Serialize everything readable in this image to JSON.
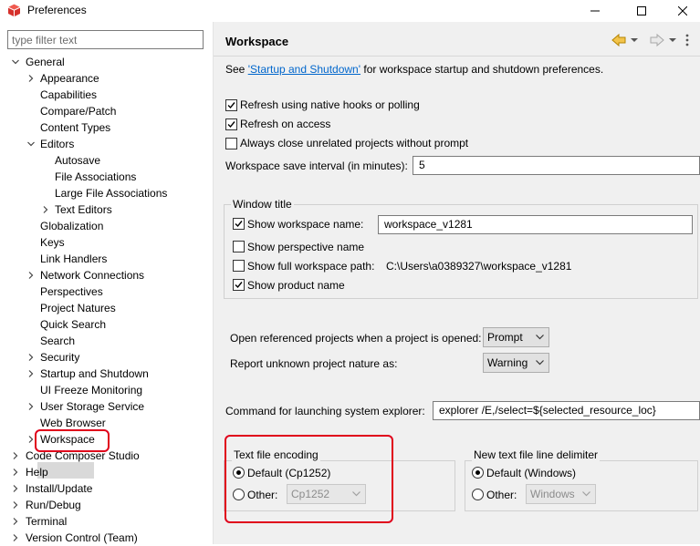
{
  "window": {
    "title": "Preferences",
    "icon": "preferences-app-icon",
    "controls": [
      "minimize-icon",
      "maximize-icon",
      "close-icon"
    ]
  },
  "filter": {
    "placeholder": "type filter text",
    "value": ""
  },
  "tree": {
    "general": "General",
    "appearance": "Appearance",
    "capabilities": "Capabilities",
    "compare_patch": "Compare/Patch",
    "content_types": "Content Types",
    "editors": "Editors",
    "autosave": "Autosave",
    "file_associations": "File Associations",
    "large_file_associations": "Large File Associations",
    "text_editors": "Text Editors",
    "globalization": "Globalization",
    "keys": "Keys",
    "link_handlers": "Link Handlers",
    "network_connections": "Network Connections",
    "perspectives": "Perspectives",
    "project_natures": "Project Natures",
    "quick_search": "Quick Search",
    "search": "Search",
    "security": "Security",
    "startup_shutdown": "Startup and Shutdown",
    "ui_freeze_monitoring": "UI Freeze Monitoring",
    "user_storage_service": "User Storage Service",
    "web_browser": "Web Browser",
    "workspace": "Workspace",
    "code_composer_studio": "Code Composer Studio",
    "help": "Help",
    "install_update": "Install/Update",
    "run_debug": "Run/Debug",
    "terminal": "Terminal",
    "version_control": "Version Control (Team)"
  },
  "page": {
    "title": "Workspace",
    "see_prefix": "See ",
    "see_link": "'Startup and Shutdown'",
    "see_suffix": " for workspace startup and shutdown preferences.",
    "refresh_native": "Refresh using native hooks or polling",
    "refresh_access": "Refresh on access",
    "always_close": "Always close unrelated projects without prompt",
    "save_interval_label": "Workspace save interval (in minutes):",
    "save_interval_value": "5",
    "window_title": {
      "group": "Window title",
      "show_workspace_name": "Show workspace name:",
      "workspace_name_value": "workspace_v1281",
      "show_perspective_name": "Show perspective name",
      "show_full_path": "Show full workspace path:",
      "full_path_value": "C:\\Users\\a0389327\\workspace_v1281",
      "show_product_name": "Show product name"
    },
    "open_referenced_label": "Open referenced projects when a project is opened:",
    "open_referenced_value": "Prompt",
    "unknown_nature_label": "Report unknown project nature as:",
    "unknown_nature_value": "Warning",
    "command_label": "Command for launching system explorer:",
    "command_value": "explorer /E,/select=${selected_resource_loc}",
    "encoding": {
      "group": "Text file encoding",
      "default": "Default (Cp1252)",
      "other": "Other:",
      "other_value": "Cp1252"
    },
    "delimiter": {
      "group": "New text file line delimiter",
      "default": "Default (Windows)",
      "other": "Other:",
      "other_value": "Windows"
    }
  },
  "colors": {
    "highlight": "#e0001b",
    "link": "#0066cc",
    "selection": "#d9d9d9"
  }
}
